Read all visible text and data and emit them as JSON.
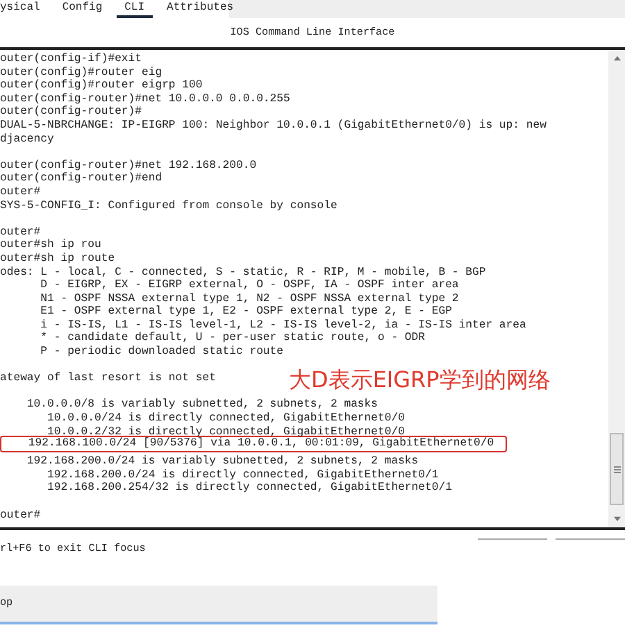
{
  "tabs": [
    {
      "label": "ysical",
      "selected": false
    },
    {
      "label": "Config",
      "selected": false
    },
    {
      "label": "CLI",
      "selected": true
    },
    {
      "label": "Attributes",
      "selected": false
    }
  ],
  "panel_title": "IOS Command Line Interface",
  "terminal": {
    "lines": [
      {
        "kind": "text",
        "text": "outer(config-if)#exit"
      },
      {
        "kind": "text",
        "text": "outer(config)#router eig"
      },
      {
        "kind": "text",
        "text": "outer(config)#router eigrp 100"
      },
      {
        "kind": "text",
        "text": "outer(config-router)#net 10.0.0.0 0.0.0.255"
      },
      {
        "kind": "text",
        "text": "outer(config-router)#"
      },
      {
        "kind": "text",
        "text": "DUAL-5-NBRCHANGE: IP-EIGRP 100: Neighbor 10.0.0.1 (GigabitEthernet0/0) is up: new"
      },
      {
        "kind": "text",
        "text": "djacency"
      },
      {
        "kind": "blank"
      },
      {
        "kind": "text",
        "text": "outer(config-router)#net 192.168.200.0"
      },
      {
        "kind": "text",
        "text": "outer(config-router)#end"
      },
      {
        "kind": "text",
        "text": "outer#"
      },
      {
        "kind": "text",
        "text": "SYS-5-CONFIG_I: Configured from console by console"
      },
      {
        "kind": "blank"
      },
      {
        "kind": "text",
        "text": "outer#"
      },
      {
        "kind": "text",
        "text": "outer#sh ip rou"
      },
      {
        "kind": "text",
        "text": "outer#sh ip route"
      },
      {
        "kind": "text",
        "text": "odes: L - local, C - connected, S - static, R - RIP, M - mobile, B - BGP"
      },
      {
        "kind": "text",
        "text": "      D - EIGRP, EX - EIGRP external, O - OSPF, IA - OSPF inter area"
      },
      {
        "kind": "text",
        "text": "      N1 - OSPF NSSA external type 1, N2 - OSPF NSSA external type 2"
      },
      {
        "kind": "text",
        "text": "      E1 - OSPF external type 1, E2 - OSPF external type 2, E - EGP"
      },
      {
        "kind": "text",
        "text": "      i - IS-IS, L1 - IS-IS level-1, L2 - IS-IS level-2, ia - IS-IS inter area"
      },
      {
        "kind": "text",
        "text": "      * - candidate default, U - per-user static route, o - ODR"
      },
      {
        "kind": "text",
        "text": "      P - periodic downloaded static route"
      },
      {
        "kind": "blank"
      },
      {
        "kind": "text",
        "text": "ateway of last resort is not set"
      },
      {
        "kind": "blank"
      },
      {
        "kind": "text",
        "text": "    10.0.0.0/8 is variably subnetted, 2 subnets, 2 masks"
      },
      {
        "kind": "text",
        "text": "       10.0.0.0/24 is directly connected, GigabitEthernet0/0"
      },
      {
        "kind": "text",
        "text": "       10.0.0.2/32 is directly connected, GigabitEthernet0/0"
      },
      {
        "kind": "highlight",
        "text": "    192.168.100.0/24 [90/5376] via 10.0.0.1, 00:01:09, GigabitEthernet0/0"
      },
      {
        "kind": "text",
        "text": "    192.168.200.0/24 is variably subnetted, 2 subnets, 2 masks"
      },
      {
        "kind": "text",
        "text": "       192.168.200.0/24 is directly connected, GigabitEthernet0/1"
      },
      {
        "kind": "text",
        "text": "       192.168.200.254/32 is directly connected, GigabitEthernet0/1"
      },
      {
        "kind": "blank"
      },
      {
        "kind": "text",
        "text": "outer#"
      }
    ],
    "annotation": "大D表示EIGRP学到的网络"
  },
  "focus_hint": "rl+F6 to exit CLI focus",
  "bottom_bar": {
    "label": "op"
  }
}
